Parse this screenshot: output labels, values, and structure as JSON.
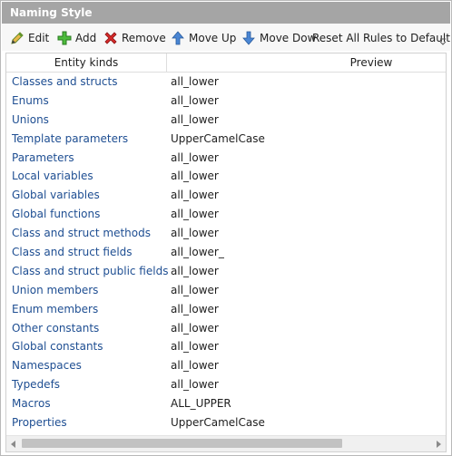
{
  "panel": {
    "title": "Naming Style"
  },
  "toolbar": {
    "edit_label": "Edit",
    "add_label": "Add",
    "remove_label": "Remove",
    "move_up_label": "Move Up",
    "move_down_label": "Move Dow",
    "reset_label": "Reset All Rules to Default"
  },
  "grid": {
    "columns": [
      "Entity kinds",
      "Preview"
    ],
    "rows": [
      {
        "kind": "Classes and structs",
        "preview": "all_lower"
      },
      {
        "kind": "Enums",
        "preview": "all_lower"
      },
      {
        "kind": "Unions",
        "preview": "all_lower"
      },
      {
        "kind": "Template parameters",
        "preview": "UpperCamelCase"
      },
      {
        "kind": "Parameters",
        "preview": "all_lower"
      },
      {
        "kind": "Local variables",
        "preview": "all_lower"
      },
      {
        "kind": "Global variables",
        "preview": "all_lower"
      },
      {
        "kind": "Global functions",
        "preview": "all_lower"
      },
      {
        "kind": "Class and struct methods",
        "preview": "all_lower"
      },
      {
        "kind": "Class and struct fields",
        "preview": "all_lower_"
      },
      {
        "kind": "Class and struct public fields",
        "preview": "all_lower"
      },
      {
        "kind": "Union members",
        "preview": "all_lower"
      },
      {
        "kind": "Enum members",
        "preview": "all_lower"
      },
      {
        "kind": "Other constants",
        "preview": "all_lower"
      },
      {
        "kind": "Global constants",
        "preview": "all_lower"
      },
      {
        "kind": "Namespaces",
        "preview": "all_lower"
      },
      {
        "kind": "Typedefs",
        "preview": "all_lower"
      },
      {
        "kind": "Macros",
        "preview": "ALL_UPPER"
      },
      {
        "kind": "Properties",
        "preview": "UpperCamelCase"
      }
    ]
  },
  "colors": {
    "title_bg": "#a5a5a5",
    "entity_text": "#1e4e92",
    "add_green": "#3aa53a",
    "remove_red": "#d32020",
    "arrow_blue": "#3c78c8"
  }
}
